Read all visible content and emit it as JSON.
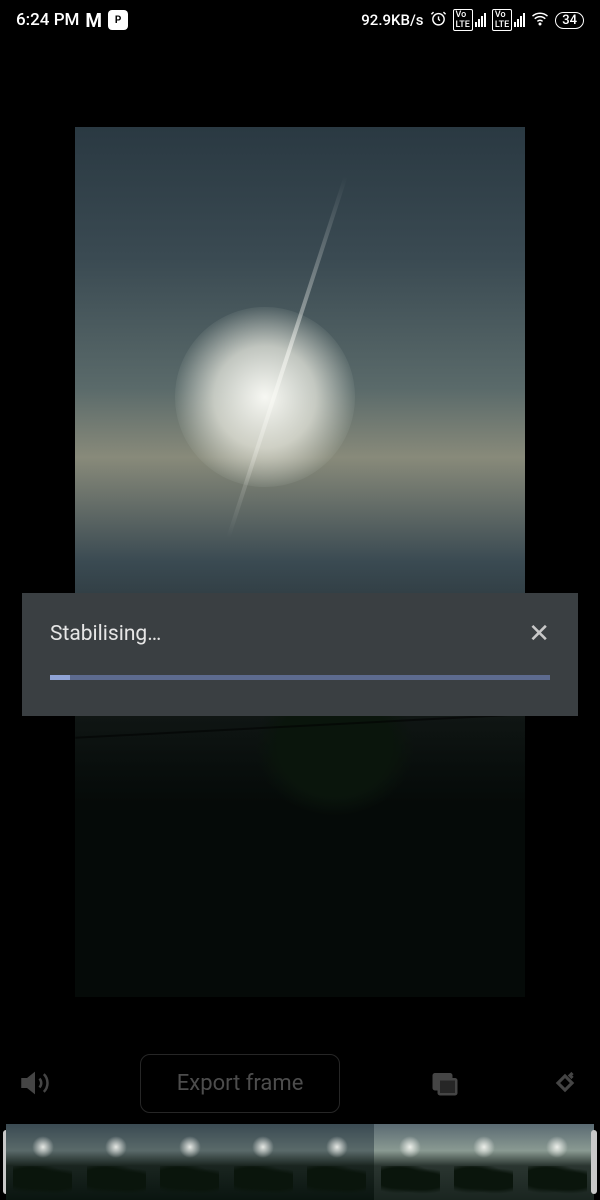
{
  "status": {
    "time": "6:24 PM",
    "net_speed": "92.9KB/s",
    "battery": "34"
  },
  "dialog": {
    "title": "Stabilising…",
    "progress_percent": 4
  },
  "toolbar": {
    "export_label": "Export frame"
  },
  "filmstrip": {
    "frame_count": 8
  }
}
